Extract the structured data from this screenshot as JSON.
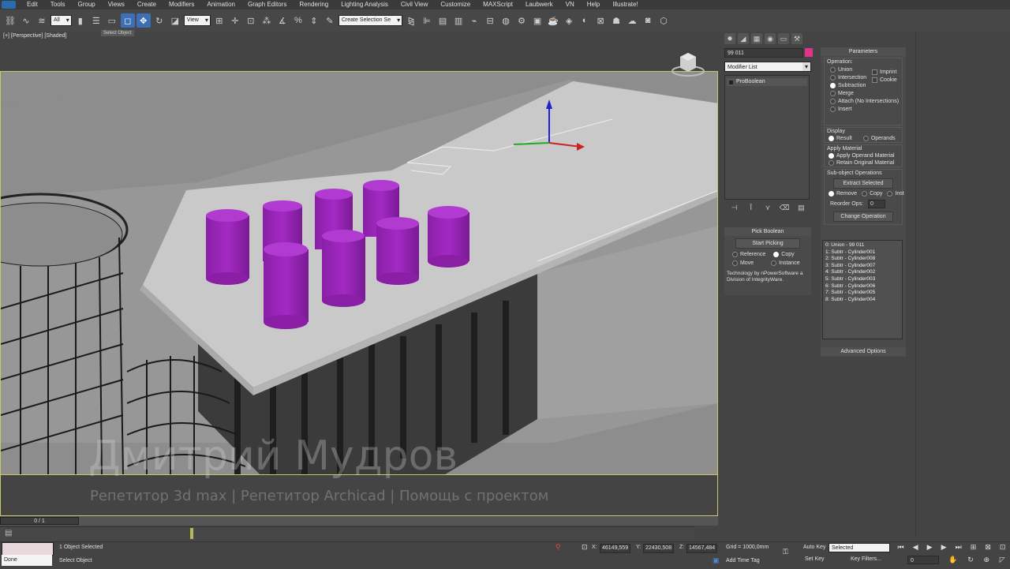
{
  "menu": {
    "items": [
      "Edit",
      "Tools",
      "Group",
      "Views",
      "Create",
      "Modifiers",
      "Animation",
      "Graph Editors",
      "Rendering",
      "Lighting Analysis",
      "Civil View",
      "Customize",
      "MAXScript",
      "Laubwerk",
      "VN",
      "Help",
      "Illustrate!"
    ]
  },
  "toolbar": {
    "selection_filter": "All",
    "ref_coord": "View",
    "named_selection": "Create Selection Se",
    "tooltip": "Select Object"
  },
  "viewport": {
    "label": "[+] [Perspective] [Shaded]",
    "watermark_name": "Дмитрий Мудров",
    "watermark_sub": "Репетитор 3d max  |  Репетитор Archicad  |  Помощь с проектом"
  },
  "command_panel": {
    "object_name": "99   011",
    "object_color": "#e0348a",
    "modifier_list": "Modifier List",
    "stack": [
      "ProBoolean"
    ],
    "pick_boolean": {
      "title": "Pick Boolean",
      "start_picking": "Start Picking",
      "options": [
        {
          "label": "Reference",
          "selected": false
        },
        {
          "label": "Copy",
          "selected": true
        },
        {
          "label": "Move",
          "selected": false
        },
        {
          "label": "Instance",
          "selected": false
        }
      ],
      "credit": "Technology by nPowerSoftware a Division of IntegrityWare."
    }
  },
  "parameters": {
    "title": "Parameters",
    "operation_label": "Operation:",
    "operations": [
      {
        "label": "Union",
        "selected": false
      },
      {
        "label": "Intersection",
        "selected": false
      },
      {
        "label": "Subtraction",
        "selected": true
      },
      {
        "label": "Merge",
        "selected": false
      },
      {
        "label": "Attach (No Intersections)",
        "selected": false
      },
      {
        "label": "Insert",
        "selected": false
      }
    ],
    "checks": [
      {
        "label": "Imprint",
        "checked": false
      },
      {
        "label": "Cookie",
        "checked": false
      }
    ],
    "display_label": "Display",
    "display_options": [
      {
        "label": "Result",
        "selected": true
      },
      {
        "label": "Operands",
        "selected": false
      }
    ],
    "apply_material_label": "Apply Material",
    "apply_material_options": [
      {
        "label": "Apply Operand Material",
        "selected": true
      },
      {
        "label": "Retain Original Material",
        "selected": false
      }
    ],
    "subobject_label": "Sub-object Operations",
    "extract_selected": "Extract Selected",
    "extract_options": [
      {
        "label": "Remove",
        "selected": true
      },
      {
        "label": "Copy",
        "selected": false
      },
      {
        "label": "Inst",
        "selected": false
      }
    ],
    "reorder_label": "Reorder Ops:",
    "reorder_value": "0",
    "change_operation": "Change Operation",
    "op_list": [
      "0: Union - 99   011",
      "1: Subtr - Cylinder001",
      "2: Subtr - Cylinder008",
      "3: Subtr - Cylinder007",
      "4: Subtr - Cylinder002",
      "5: Subtr - Cylinder003",
      "6: Subtr - Cylinder006",
      "7: Subtr - Cylinder005",
      "8: Subtr - Cylinder004"
    ],
    "advanced_options": "Advanced Options"
  },
  "timeline": {
    "frame_counter": "0 / 1"
  },
  "status": {
    "done_label": "Done",
    "selection_status": "1 Object Selected",
    "prompt": "Select Object",
    "x": "46149,559",
    "y": "22430,508",
    "z": "14567,484",
    "grid": "Grid = 1000,0mm",
    "add_time_tag": "Add Time Tag",
    "auto_key": "Auto Key",
    "set_key": "Set Key",
    "key_mode": "Selected",
    "key_filters": "Key Filters...",
    "current_frame": "0"
  }
}
